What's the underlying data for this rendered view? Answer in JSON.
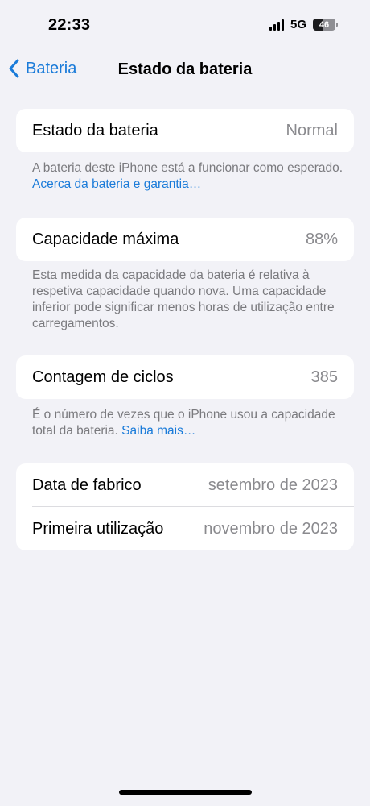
{
  "status_bar": {
    "time": "22:33",
    "network": "5G",
    "battery_level": "46",
    "battery_fraction": 0.46,
    "signal_icon": "signal-bars-icon",
    "battery_icon": "battery-icon"
  },
  "nav": {
    "back_label": "Bateria",
    "back_icon": "chevron-left-icon",
    "title": "Estado da bateria"
  },
  "colors": {
    "background": "#f2f2f7",
    "card": "#ffffff",
    "link": "#1a7bd9",
    "secondary_text": "#8a8a8e"
  },
  "battery_state": {
    "label": "Estado da bateria",
    "value": "Normal",
    "footer_text": "A bateria deste iPhone está a funcionar como esperado. ",
    "footer_link": "Acerca da bateria e garantia…"
  },
  "max_capacity": {
    "label": "Capacidade máxima",
    "value": "88%",
    "footer_text": "Esta medida da capacidade da bateria é relativa à respetiva capacidade quando nova. Uma capacidade inferior pode significar menos horas de utilização entre carregamentos."
  },
  "cycle_count": {
    "label": "Contagem de ciclos",
    "value": "385",
    "footer_text": "É o número de vezes que o iPhone usou a capacidade total da bateria. ",
    "footer_link": "Saiba mais…"
  },
  "dates": {
    "manufacture_label": "Data de fabrico",
    "manufacture_value": "setembro de 2023",
    "first_use_label": "Primeira utilização",
    "first_use_value": "novembro de 2023"
  }
}
